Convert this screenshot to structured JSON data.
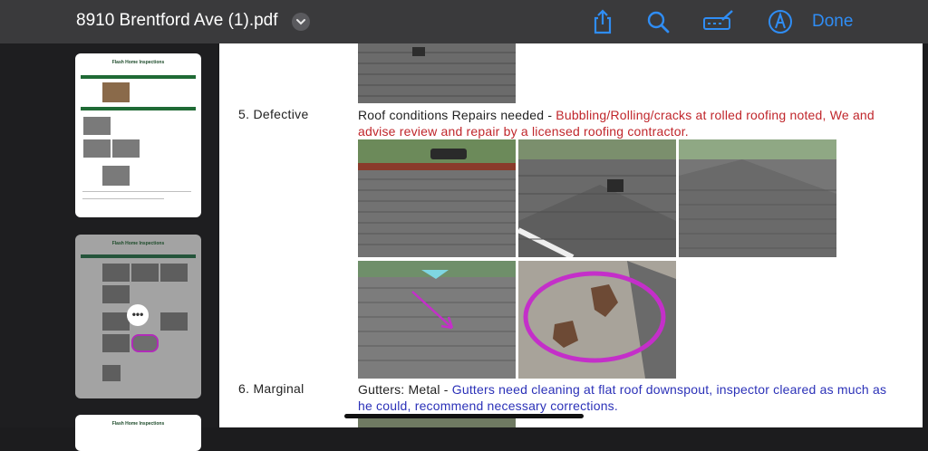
{
  "toolbar": {
    "title": "8910 Brentford Ave (1).pdf",
    "done_label": "Done",
    "icons": [
      "chevron-down-icon",
      "share-icon",
      "search-icon",
      "markup-icon",
      "pen-icon"
    ],
    "accent_color": "#2f8df5"
  },
  "sidebar": {
    "thumbnails": [
      {
        "header": "Flash Home Inspections",
        "section": "Exterior (Continued)"
      },
      {
        "header": "Flash Home Inspections",
        "section": "Roof (Continued)"
      },
      {
        "header": "Flash Home Inspections"
      }
    ],
    "more_label": "•••"
  },
  "document": {
    "items": [
      {
        "label": "5. Defective",
        "prefix": "Roof conditions Repairs needed - ",
        "comment": "Bubbling/Rolling/cracks at rolled roofing noted, We and advise review and repair by a licensed roofing contractor.",
        "comment_color": "#c0262b"
      },
      {
        "label": "6. Marginal",
        "prefix": "Gutters: Metal - ",
        "comment": "Gutters need cleaning at flat roof downspout, inspector cleared as much as he could, recommend necessary corrections.",
        "comment_color": "#2b31b8"
      }
    ]
  }
}
